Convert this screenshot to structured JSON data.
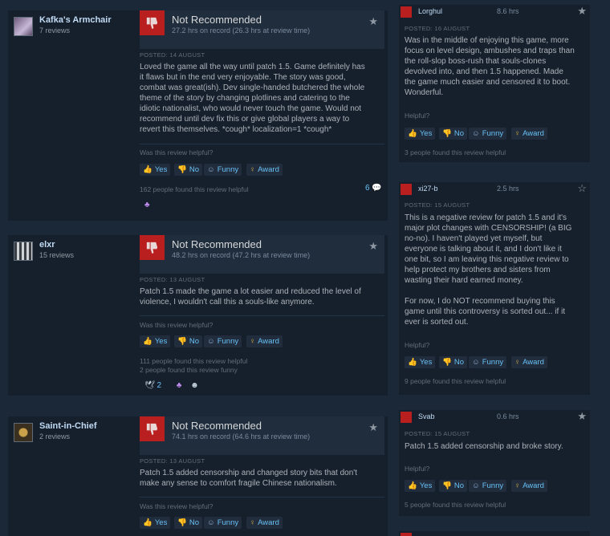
{
  "verdict_label": "Not Recommended",
  "posted_prefix": "POSTED:",
  "helpful_question": "Was this review helpful?",
  "helpful_short": "Helpful?",
  "buttons": {
    "yes": "Yes",
    "no": "No",
    "funny": "Funny",
    "award": "Award"
  },
  "colors": {
    "background": "#1b2838",
    "card": "#16202d",
    "thumb_down": "#b91f1f",
    "link": "#67c1f5"
  },
  "left_reviews": [
    {
      "username": "Kafka's Armchair",
      "reviews": "7 reviews",
      "hours": "27.2 hrs on record (26.3 hrs at review time)",
      "posted": "POSTED: 14 AUGUST",
      "text": "Loved the game all the way until patch 1.5. Game definitely has\nit flaws but in the end very enjoyable. The story was good,\ncombat was great(ish). Dev single-handed butchered the whole\ntheme of the story by changing plotlines and catering to the\nidiotic nationalist, who would never touch the game. Would not\nrecommend until dev fix this or give global players a way to\nrevert this themselves. *cough* localization=1 *cough*",
      "found": "162 people found this review helpful",
      "comments": "6"
    },
    {
      "username": "elxr",
      "reviews": "15 reviews",
      "hours": "48.2 hrs on record (47.2 hrs at review time)",
      "posted": "POSTED: 13 AUGUST",
      "text": "Patch 1.5 made the game a lot easier and reduced the level of\nviolence, I wouldn't call this a souls-like anymore.",
      "found": "111 people found this review helpful\n2 people found this review funny",
      "react_count": "2"
    },
    {
      "username": "Saint-in-Chief",
      "reviews": "2 reviews",
      "hours": "74.1 hrs on record (64.6 hrs at review time)",
      "posted": "POSTED: 13 AUGUST",
      "text": "Patch 1.5 added censorship and changed story bits that don't\nmake any sense to comfort fragile Chinese nationalism."
    }
  ],
  "right_reviews": [
    {
      "username": "Lorghul",
      "hours": "8.6 hrs",
      "posted": "POSTED: 16 AUGUST",
      "text": "Was in the middle of enjoying this game, more\nfocus on level design, ambushes and traps than\nthe roll-slop boss-rush that souls-clones\ndevolved into, and then 1.5 happened. Made\nthe game much easier and censored it to boot.\nWonderful.",
      "found": "3 people found this review helpful"
    },
    {
      "username": "xi27-b",
      "hours": "2.5 hrs",
      "posted": "POSTED: 15 AUGUST",
      "text": "This is a negative review for patch 1.5 and it's\nmajor plot changes with CENSORSHIP! (a BIG\nno-no). I haven't played yet myself, but\neveryone is talking about it, and I don't like it\none bit, so I am leaving this negative review to\nhelp protect my brothers and sisters from\nwasting their hard earned money.\n\nFor now, I do NOT recommend buying this\ngame until this controversy is sorted out... if it\never is sorted out.",
      "found": "9 people found this review helpful"
    },
    {
      "username": "Svab",
      "hours": "0.6 hrs",
      "posted": "POSTED: 15 AUGUST",
      "text": "Patch 1.5 added censorship and broke story.",
      "found": "5 people found this review helpful"
    }
  ]
}
